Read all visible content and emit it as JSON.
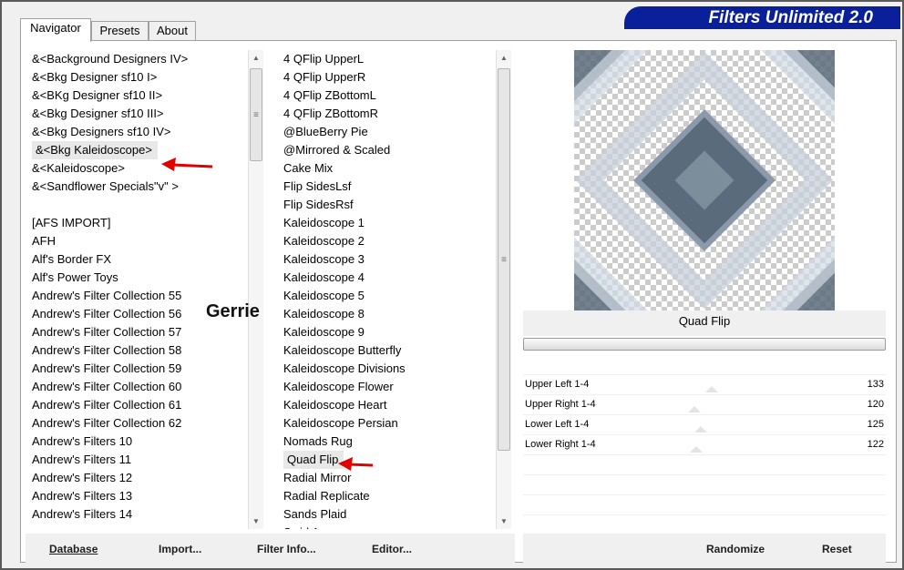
{
  "banner": {
    "title": "Filters Unlimited 2.0"
  },
  "tabs": [
    "Navigator",
    "Presets",
    "About"
  ],
  "watermark": "Gerrie",
  "categories": [
    "&<Background Designers IV>",
    "&<Bkg Designer sf10 I>",
    "&<BKg Designer sf10 II>",
    "&<Bkg Designer sf10 III>",
    "&<Bkg Designers sf10 IV>",
    "&<Bkg Kaleidoscope>",
    "&<Kaleidoscope>",
    "&<Sandflower Specials\"v\" >",
    "",
    "[AFS IMPORT]",
    "AFH",
    "Alf's Border FX",
    "Alf's Power Toys",
    "Andrew's Filter Collection 55",
    "Andrew's Filter Collection 56",
    "Andrew's Filter Collection 57",
    "Andrew's Filter Collection 58",
    "Andrew's Filter Collection 59",
    "Andrew's Filter Collection 60",
    "Andrew's Filter Collection 61",
    "Andrew's Filter Collection 62",
    "Andrew's Filters 10",
    "Andrew's Filters 11",
    "Andrew's Filters 12",
    "Andrew's Filters 13",
    "Andrew's Filters 14"
  ],
  "selected_category": "&<Bkg Kaleidoscope>",
  "filters": [
    "4 QFlip UpperL",
    "4 QFlip UpperR",
    "4 QFlip ZBottomL",
    "4 QFlip ZBottomR",
    "@BlueBerry Pie",
    "@Mirrored & Scaled",
    "Cake Mix",
    "Flip SidesLsf",
    "Flip SidesRsf",
    "Kaleidoscope 1",
    "Kaleidoscope 2",
    "Kaleidoscope 3",
    "Kaleidoscope 4",
    "Kaleidoscope 5",
    "Kaleidoscope 8",
    "Kaleidoscope 9",
    "Kaleidoscope Butterfly",
    "Kaleidoscope Divisions",
    "Kaleidoscope Flower",
    "Kaleidoscope Heart",
    "Kaleidoscope Persian",
    "Nomads Rug",
    "Quad Flip",
    "Radial Mirror",
    "Radial Replicate",
    "Sands Plaid",
    "Swirl Away"
  ],
  "selected_filter": "Quad Flip",
  "filter_title": "Quad Flip",
  "params": [
    {
      "label": "Upper Left 1-4",
      "value": "133"
    },
    {
      "label": "Upper Right 1-4",
      "value": "120"
    },
    {
      "label": "Lower Left 1-4",
      "value": "125"
    },
    {
      "label": "Lower Right 1-4",
      "value": "122"
    }
  ],
  "buttons": {
    "database": "Database",
    "import": "Import...",
    "filter_info": "Filter Info...",
    "editor": "Editor...",
    "randomize": "Randomize",
    "reset": "Reset"
  },
  "colors": {
    "banner": "#0a1f9a",
    "arrow": "#e00000",
    "preview_dark": "#5a6b7b"
  }
}
